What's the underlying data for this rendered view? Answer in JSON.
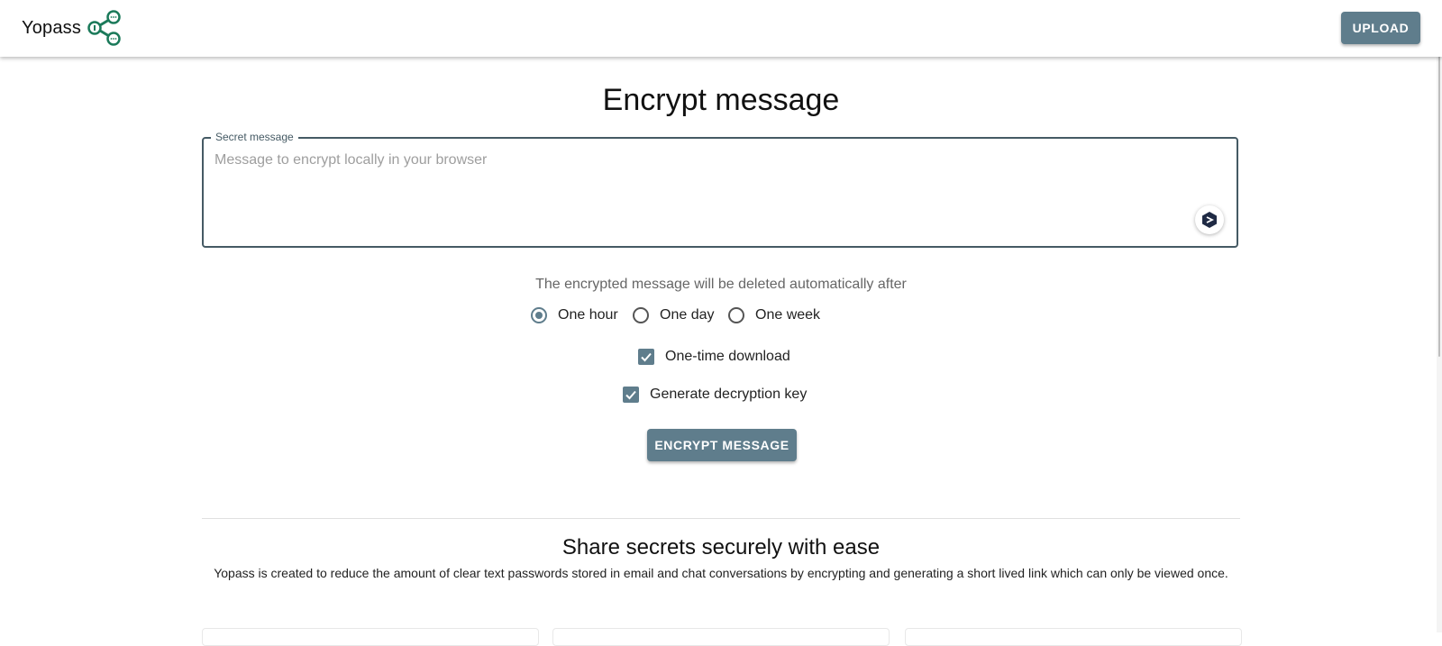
{
  "header": {
    "brand": "Yopass",
    "logo_icon": "share-nodes-icon",
    "upload_label": "UPLOAD"
  },
  "main": {
    "title": "Encrypt message",
    "secret_field": {
      "label": "Secret message",
      "placeholder": "Message to encrypt locally in your browser",
      "value": ""
    },
    "extension_icon": "extension-badge-icon",
    "expiration": {
      "label": "The encrypted message will be deleted automatically after",
      "options": [
        {
          "label": "One hour",
          "selected": true
        },
        {
          "label": "One day",
          "selected": false
        },
        {
          "label": "One week",
          "selected": false
        }
      ]
    },
    "one_time_download": {
      "label": "One-time download",
      "checked": true
    },
    "generate_key": {
      "label": "Generate decryption key",
      "checked": true
    },
    "encrypt_label": "ENCRYPT MESSAGE"
  },
  "info": {
    "title": "Share secrets securely with ease",
    "description": "Yopass is created to reduce the amount of clear text passwords stored in email and chat conversations by encrypting and generating a short lived link which can only be viewed once."
  },
  "colors": {
    "accent": "#5f7d8c",
    "field_border": "#455a64",
    "logo": "#1b7a5a"
  }
}
